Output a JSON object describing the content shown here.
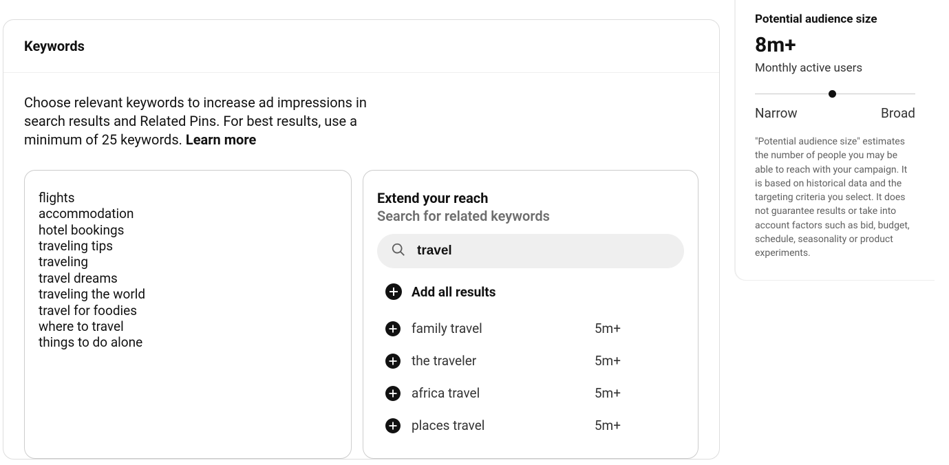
{
  "panel": {
    "title": "Keywords",
    "description_part1": "Choose relevant keywords to increase ad impressions in search results and Related Pins. For best results, use a minimum of 25 keywords. ",
    "learn_more": "Learn more"
  },
  "selected_keywords": "flights\naccommodation\nhotel bookings\ntraveling tips\ntraveling\ntravel dreams\ntraveling the world\ntravel for foodies\nwhere to travel\nthings to do alone",
  "extend": {
    "title": "Extend your reach",
    "subtitle": "Search for related keywords",
    "search_value": "travel",
    "add_all": "Add all results",
    "results": [
      {
        "label": "family travel",
        "count": "5m+"
      },
      {
        "label": "the traveler",
        "count": "5m+"
      },
      {
        "label": "africa travel",
        "count": "5m+"
      },
      {
        "label": "places travel",
        "count": "5m+"
      }
    ]
  },
  "audience": {
    "title": "Potential audience size",
    "value": "8m+",
    "subtitle": "Monthly active users",
    "narrow": "Narrow",
    "broad": "Broad",
    "explain": "\"Potential audience size\" estimates the number of people you may be able to reach with your campaign. It is based on historical data and the targeting criteria you select. It does not guarantee results or take into account factors such as bid, budget, schedule, seasonality or product experiments."
  }
}
